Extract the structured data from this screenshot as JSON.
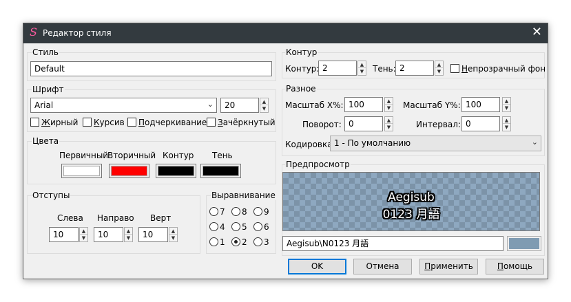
{
  "window": {
    "app_icon": "S",
    "title": "Редактор стиля",
    "close_glyph": "✕"
  },
  "style": {
    "group_label": "Стиль",
    "name": "Default"
  },
  "font": {
    "group_label": "Шрифт",
    "family": "Arial",
    "size": "20",
    "bold_prefix": "",
    "bold_key": "Ж",
    "bold_rest": "ирный",
    "italic_prefix": "",
    "italic_key": "К",
    "italic_rest": "урсив",
    "underline_prefix": "",
    "underline_key": "П",
    "underline_rest": "одчеркивание",
    "strike_prefix": "",
    "strike_key": "З",
    "strike_rest": "ачёркнутый"
  },
  "colors": {
    "group_label": "Цвета",
    "primary_label": "Первичный",
    "secondary_label": "Вторичный",
    "outline_label": "Контур",
    "shadow_label": "Тень",
    "primary": "#ffffff",
    "secondary": "#ff0000",
    "outline": "#000000",
    "shadow": "#000000"
  },
  "margins": {
    "group_label": "Отступы",
    "left_label": "Слева",
    "right_label": "Направо",
    "vert_label": "Верт",
    "left": "10",
    "right": "10",
    "vert": "10"
  },
  "alignment": {
    "group_label": "Выравнивание",
    "options": [
      "7",
      "8",
      "9",
      "4",
      "5",
      "6",
      "1",
      "2",
      "3"
    ],
    "selected": "2"
  },
  "border": {
    "group_label": "Контур",
    "outline_label": "Контур:",
    "outline": "2",
    "shadow_label": "Тень:",
    "shadow": "2",
    "opaque_key": "Н",
    "opaque_rest": "епрозрачный фон"
  },
  "misc": {
    "group_label": "Разное",
    "scale_x_label": "Масштаб X%:",
    "scale_x": "100",
    "scale_y_label": "Масштаб Y%:",
    "scale_y": "100",
    "rotation_label": "Поворот:",
    "rotation": "0",
    "spacing_label": "Интервал:",
    "spacing": "0",
    "encoding_label": "Кодировка:",
    "encoding": "1 - По умолчанию"
  },
  "preview": {
    "group_label": "Предпросмотр",
    "line1": "Aegisub",
    "line2": "0123 月語",
    "text_value": "Aegisub\\N0123 月語",
    "bg_color": "#7f9bb2"
  },
  "buttons": {
    "ok": "OK",
    "cancel": "Отмена",
    "apply_key": "П",
    "apply_rest": "рименить",
    "help_key": "П",
    "help_rest": "омощь"
  }
}
